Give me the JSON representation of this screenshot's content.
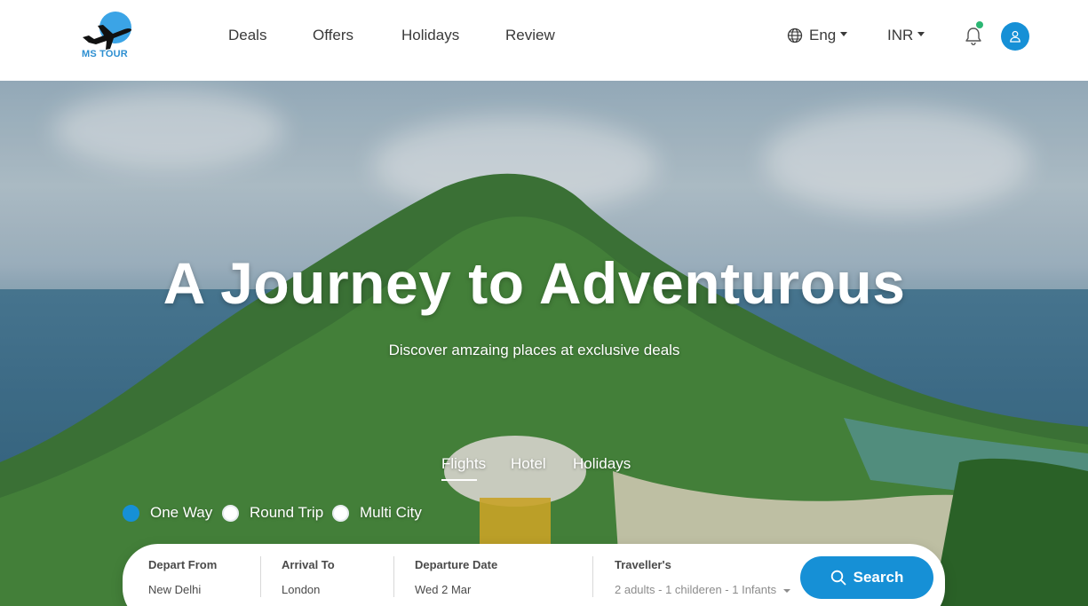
{
  "brand": {
    "name": "MS TOUR",
    "accent": "#1690d6",
    "logo_circle": "#3ba4e6"
  },
  "nav": {
    "items": [
      "Deals",
      "Offers",
      "Holidays",
      "Review"
    ]
  },
  "header": {
    "language": "Eng",
    "currency": "INR",
    "icons": {
      "language": "globe-icon",
      "notifications": "bell-icon",
      "profile": "user-icon"
    },
    "notification_dot_color": "#2bb673"
  },
  "hero": {
    "title": "A Journey to Adventurous",
    "subtitle": "Discover amzaing places at exclusive deals"
  },
  "tabs": {
    "items": [
      "Flights",
      "Hotel",
      "Holidays"
    ],
    "active": "Flights"
  },
  "trip_type": {
    "options": [
      "One Way",
      "Round Trip",
      "Multi City"
    ],
    "selected": "One Way"
  },
  "search": {
    "depart_from": {
      "label": "Depart From",
      "value": "New Delhi"
    },
    "arrival_to": {
      "label": "Arrival To",
      "value": "London"
    },
    "departure_date": {
      "label": "Departure Date",
      "value": "Wed 2 Mar"
    },
    "travellers": {
      "label": "Traveller's",
      "value": "2 adults - 1 childeren - 1 Infants"
    },
    "button_label": "Search"
  }
}
